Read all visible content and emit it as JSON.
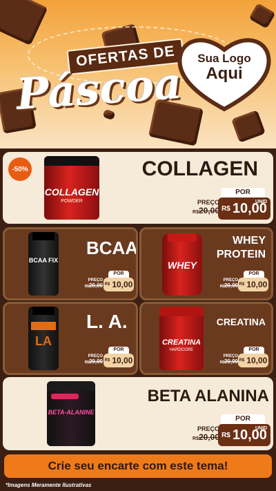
{
  "header": {
    "title_top": "OFERTAS DE",
    "title_main": "Páscoa",
    "logo_line1": "Sua Logo",
    "logo_line2": "Aqui"
  },
  "badge": "-50%",
  "price_labels": {
    "por": "POR",
    "preco": "PREÇO",
    "unid": "UNID",
    "rs": "R$"
  },
  "products": [
    {
      "name": "COLLAGEN",
      "jar_label": "COLLAGEN",
      "jar_sub": "POWDER",
      "old_prefix": "R$",
      "old_price": "20,00",
      "price": "10,00"
    },
    {
      "name": "BCAA",
      "jar_label": "BCAA FIX",
      "old_prefix": "R$",
      "old_price": "20,00",
      "price": "10,00"
    },
    {
      "name_line1": "WHEY",
      "name_line2": "PROTEIN",
      "jar_label": "WHEY",
      "old_prefix": "R$",
      "old_price": "20,00",
      "price": "10,00"
    },
    {
      "name": "L. A.",
      "jar_label": "LA",
      "old_prefix": "R$",
      "old_price": "20,00",
      "price": "10,00"
    },
    {
      "name": "CREATINA",
      "jar_label": "CREATINA",
      "jar_sub": "HARDCORE",
      "old_prefix": "R$",
      "old_price": "20,00",
      "price": "10,00"
    },
    {
      "name": "BETA ALANINA",
      "jar_label": "BETA-ALANINE",
      "old_prefix": "R$",
      "old_price": "20,00",
      "price": "10,00"
    }
  ],
  "cta": "Crie seu encarte com este tema!",
  "footnote": "*Imagens Meramente Ilustrativas",
  "colors": {
    "orange": "#ef7a1a",
    "chocolate": "#5b2c16",
    "cream": "#f6ead9",
    "price_box": "#6b2f14"
  }
}
